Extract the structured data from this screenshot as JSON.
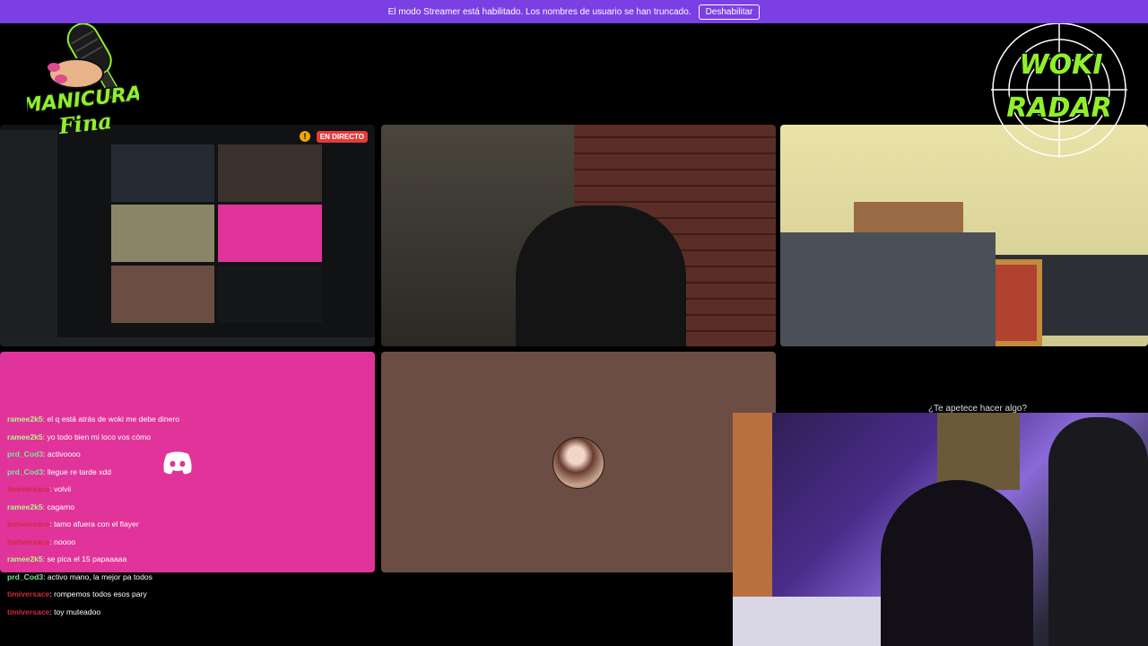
{
  "banner": {
    "message": "El modo Streamer está habilitado. Los nombres de usuario se han truncado.",
    "disable_label": "Deshabilitar"
  },
  "logos": {
    "left_line1": "MANICURA",
    "left_line2": "Fina",
    "right_line1": "WOKI",
    "right_line2": "RADAR"
  },
  "screen_share": {
    "live_label": "EN DIRECTO",
    "warning_glyph": "!"
  },
  "activity_prompt": "¿Te apetece hacer algo?",
  "chat": {
    "messages": [
      {
        "user": "ramee2k5",
        "text": "el q está atrás de woki me debe dinero",
        "color": "#b9f28a"
      },
      {
        "user": "ramee2k5",
        "text": "yo todo bien mi loco vos cómo",
        "color": "#b9f28a"
      },
      {
        "user": "prd_Cod3",
        "text": "activoooo",
        "color": "#7de39a"
      },
      {
        "user": "prd_Cod3",
        "text": "llegue re tarde xdd",
        "color": "#7de39a"
      },
      {
        "user": "timiversace",
        "text": "volvii",
        "color": "#d22a3d"
      },
      {
        "user": "ramee2k5",
        "text": "cagamo",
        "color": "#b9f28a"
      },
      {
        "user": "timiversace",
        "text": "tamo afuera con el flayer",
        "color": "#d22a3d"
      },
      {
        "user": "timiversace",
        "text": "noooo",
        "color": "#d22a3d"
      },
      {
        "user": "ramee2k5",
        "text": "se pica el 15 papaaaaa",
        "color": "#b9f28a"
      },
      {
        "user": "prd_Cod3",
        "text": "activo mano, la mejor pa todos",
        "color": "#7de39a"
      },
      {
        "user": "timiversace",
        "text": "rompemos todos esos pary",
        "color": "#d22a3d"
      },
      {
        "user": "timiversace",
        "text": "toy muteadoo",
        "color": "#d22a3d"
      }
    ]
  },
  "colors": {
    "banner": "#7b3fe4",
    "discord_pink": "#e0349a",
    "avatar_tile": "#6b4d44",
    "logo_green": "#8ef02a"
  },
  "icons": [
    "discord-icon",
    "microphone-icon",
    "crosshair-icon"
  ]
}
